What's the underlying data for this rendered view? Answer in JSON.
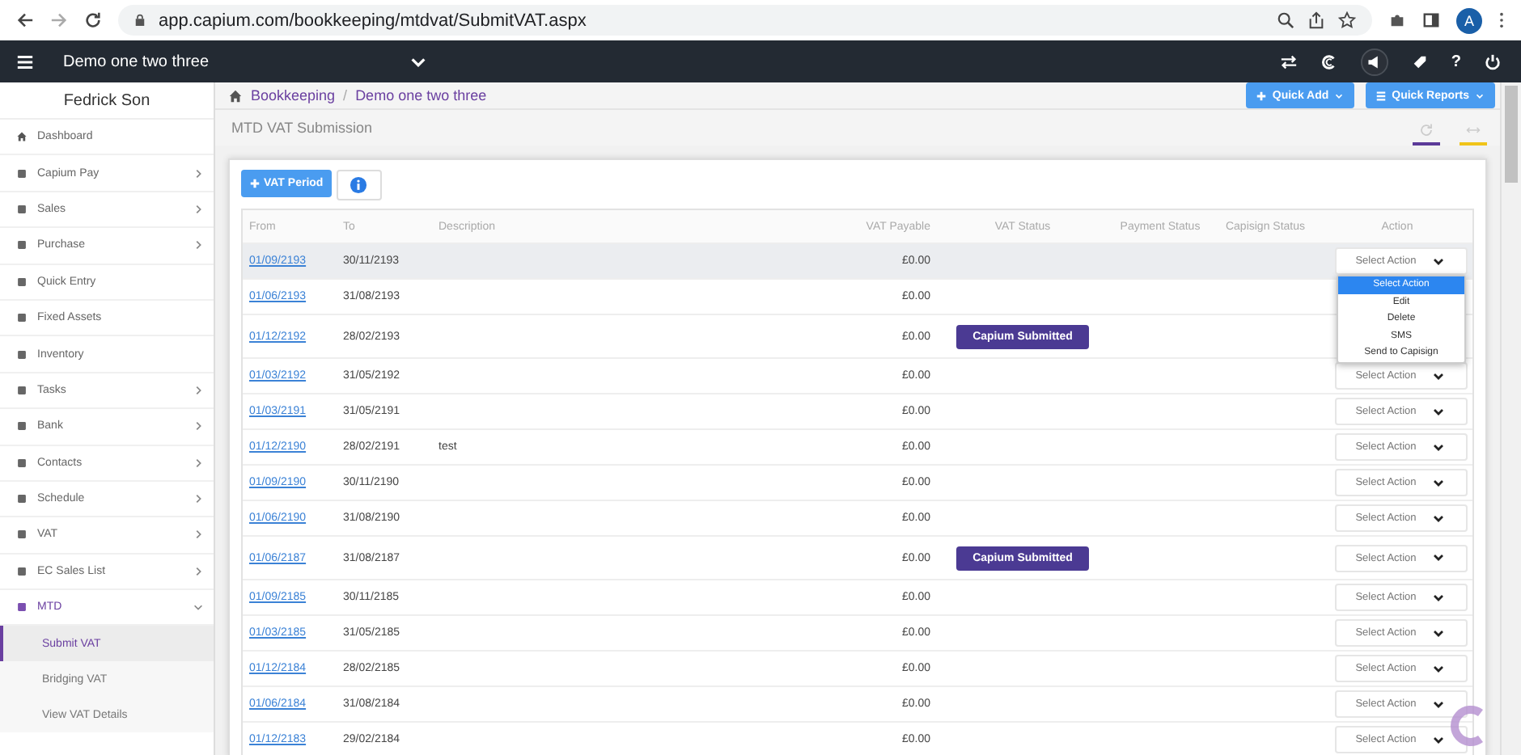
{
  "browser": {
    "url": "app.capium.com/bookkeeping/mtdvat/SubmitVAT.aspx",
    "avatar": "A"
  },
  "topbar": {
    "company": "Demo one two three",
    "help": "?"
  },
  "sidebar": {
    "user": "Fedrick Son",
    "items": [
      {
        "label": "Dashboard",
        "kind": "link"
      },
      {
        "label": "Capium Pay",
        "kind": "menu",
        "expanded": false
      },
      {
        "label": "Sales",
        "kind": "menu",
        "expanded": false
      },
      {
        "label": "Purchase",
        "kind": "menu",
        "expanded": false
      },
      {
        "label": "Quick Entry",
        "kind": "link"
      },
      {
        "label": "Fixed Assets",
        "kind": "link"
      },
      {
        "label": "Inventory",
        "kind": "link"
      },
      {
        "label": "Tasks",
        "kind": "menu",
        "expanded": false
      },
      {
        "label": "Bank",
        "kind": "menu",
        "expanded": false
      },
      {
        "label": "Contacts",
        "kind": "menu",
        "expanded": false
      },
      {
        "label": "Schedule",
        "kind": "menu",
        "expanded": false
      },
      {
        "label": "VAT",
        "kind": "menu",
        "expanded": false
      },
      {
        "label": "EC Sales List",
        "kind": "menu",
        "expanded": false
      },
      {
        "label": "MTD",
        "kind": "menu",
        "expanded": true,
        "children": [
          {
            "label": "Submit VAT",
            "selected": true
          },
          {
            "label": "Bridging VAT",
            "selected": false
          },
          {
            "label": "View VAT Details",
            "selected": false
          }
        ]
      }
    ]
  },
  "breadcrumb": [
    "Bookkeeping",
    "Demo one two three"
  ],
  "breadcrumb_separator": "/",
  "header_buttons": [
    "Quick Add",
    "Quick Reports"
  ],
  "page_title": "MTD VAT Submission",
  "toolbar": {
    "add_button": "VAT Period"
  },
  "table": {
    "columns": [
      "From",
      "To",
      "Description",
      "VAT Payable",
      "VAT Status",
      "Payment Status",
      "Capisign Status",
      "Action"
    ],
    "rows": [
      {
        "from": "01/09/2193",
        "to": "30/11/2193",
        "payable": "£0.00",
        "action": "Select Action",
        "highlighted": true
      },
      {
        "from": "01/06/2193",
        "to": "31/08/2193",
        "payable": "£0.00",
        "highlighted": false
      },
      {
        "from": "01/12/2192",
        "to": "28/02/2193",
        "payable": "£0.00",
        "status": "Capium Submitted",
        "highlighted": false
      },
      {
        "from": "01/03/2192",
        "to": "31/05/2192",
        "payable": "£0.00",
        "action": "Select Action",
        "highlighted": false
      },
      {
        "from": "01/03/2191",
        "to": "31/05/2191",
        "payable": "£0.00",
        "action": "Select Action",
        "highlighted": false
      },
      {
        "from": "01/12/2190",
        "to": "28/02/2191",
        "description": "test",
        "payable": "£0.00",
        "action": "Select Action",
        "highlighted": false
      },
      {
        "from": "01/09/2190",
        "to": "30/11/2190",
        "payable": "£0.00",
        "action": "Select Action",
        "highlighted": false
      },
      {
        "from": "01/06/2190",
        "to": "31/08/2190",
        "payable": "£0.00",
        "action": "Select Action",
        "highlighted": false
      },
      {
        "from": "01/06/2187",
        "to": "31/08/2187",
        "payable": "£0.00",
        "status": "Capium Submitted",
        "action": "Select Action",
        "highlighted": false
      },
      {
        "from": "01/09/2185",
        "to": "30/11/2185",
        "payable": "£0.00",
        "action": "Select Action",
        "highlighted": false
      },
      {
        "from": "01/03/2185",
        "to": "31/05/2185",
        "payable": "£0.00",
        "action": "Select Action",
        "highlighted": false
      },
      {
        "from": "01/12/2184",
        "to": "28/02/2185",
        "payable": "£0.00",
        "action": "Select Action",
        "highlighted": false
      },
      {
        "from": "01/06/2184",
        "to": "31/08/2184",
        "payable": "£0.00",
        "action": "Select Action",
        "highlighted": false
      },
      {
        "from": "01/12/2183",
        "to": "29/02/2184",
        "payable": "£0.00",
        "action": "Select Action",
        "highlighted": false
      }
    ]
  },
  "action_menu": [
    {
      "label": "Select Action",
      "selected": true
    },
    {
      "label": "Edit",
      "selected": false
    },
    {
      "label": "Delete",
      "selected": false
    },
    {
      "label": "SMS",
      "selected": false
    },
    {
      "label": "Send to Capisign",
      "selected": false
    }
  ]
}
